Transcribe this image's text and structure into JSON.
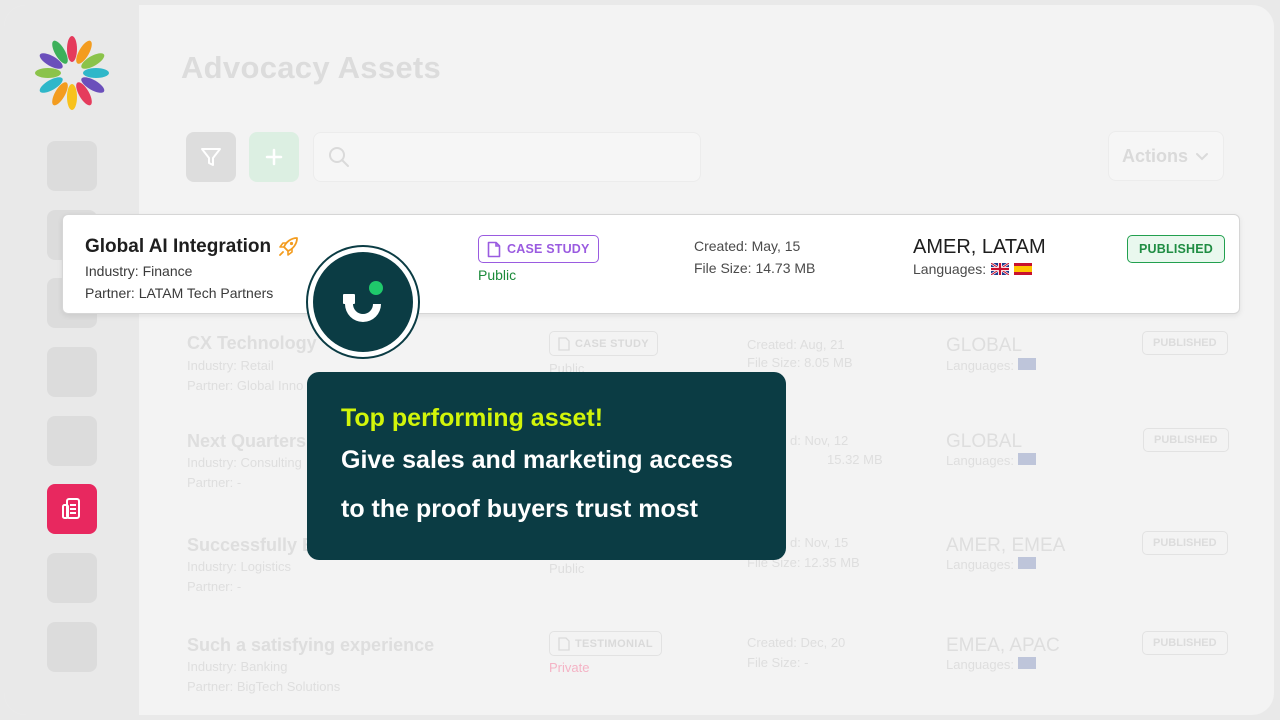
{
  "page": {
    "title": "Advocacy Assets"
  },
  "toolbar": {
    "actions_label": "Actions"
  },
  "highlight_row": {
    "title": "Global AI Integration",
    "industry": "Industry: Finance",
    "partner": "Partner: LATAM Tech Partners",
    "type": "CASE STUDY",
    "access": "Public",
    "created": "Created: May, 15",
    "file_size": "File Size: 14.73 MB",
    "region": "AMER, LATAM",
    "languages_label": "Languages:",
    "languages": [
      "uk-flag",
      "spain-flag"
    ],
    "status": "PUBLISHED"
  },
  "rows": [
    {
      "title": "CX Technology",
      "industry": "Industry: Retail",
      "partner": "Partner: Global Inno",
      "type": "CASE STUDY",
      "access": "Public",
      "created": "Created: Aug, 21",
      "file_size": "File Size: 8.05 MB",
      "region": "GLOBAL",
      "languages_label": "Languages:",
      "status": "PUBLISHED"
    },
    {
      "title": "Next Quarters",
      "industry": "Industry: Consulting",
      "partner": "Partner: -",
      "type": "",
      "access": "",
      "created": "d: Nov, 12",
      "file_size": "15.32 MB",
      "region": "GLOBAL",
      "languages_label": "Languages:",
      "status": "PUBLISHED"
    },
    {
      "title": "Successfully B",
      "industry": "Industry: Logistics",
      "partner": "Partner: -",
      "type": "",
      "access": "Public",
      "created": "d: Nov, 15",
      "file_size": "File Size: 12.35 MB",
      "region": "AMER, EMEA",
      "languages_label": "Languages:",
      "status": "PUBLISHED"
    },
    {
      "title": "Such a satisfying experience",
      "industry": "Industry: Banking",
      "partner": "Partner: BigTech Solutions",
      "type": "TESTIMONIAL",
      "access": "Private",
      "created": "Created: Dec, 20",
      "file_size": "File Size: -",
      "region": "EMEA, APAC",
      "languages_label": "Languages:",
      "status": "PUBLISHED"
    }
  ],
  "tooltip": {
    "headline": "Top performing asset!",
    "line1": "Give sales and marketing access",
    "line2": "to the proof buyers trust most"
  },
  "colors": {
    "brand_dark": "#0b3c44",
    "accent_lime": "#d2f50a",
    "active_nav": "#e8285f",
    "case_study": "#9a5be0",
    "published": "#1f8d43",
    "private": "#e8285f"
  },
  "icons": [
    "logo-flower",
    "filter-icon",
    "plus-icon",
    "search-icon",
    "chevron-down-icon",
    "rocket-icon",
    "document-icon",
    "assets-icon",
    "brand-mark"
  ]
}
